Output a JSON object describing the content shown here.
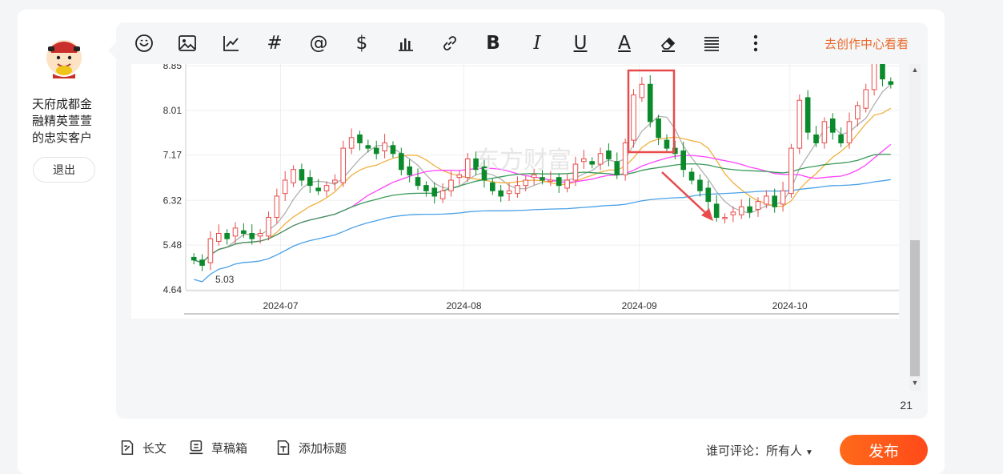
{
  "profile": {
    "name": "天府成都金融精英萱萱的忠实客户",
    "logout_label": "退出"
  },
  "toolbar": {
    "icons": [
      "emoji-icon",
      "image-icon",
      "chart-line-icon",
      "hashtag-icon",
      "mention-icon",
      "stock-dollar-icon",
      "bar-chart-icon",
      "link-icon",
      "bold-icon",
      "italic-icon",
      "underline-icon",
      "font-color-icon",
      "eraser-icon",
      "align-icon",
      "more-icon"
    ],
    "bold": "B",
    "italic": "I",
    "underline": "U",
    "font_color": "A",
    "hashtag": "#",
    "mention": "@",
    "dollar": "$",
    "creator_center_link": "去创作中心看看"
  },
  "colors": {
    "accent": "#e8692a",
    "publish": "#ff5a1f",
    "candle_up": "#e84b4b",
    "candle_down": "#0a8a2a"
  },
  "chart": {
    "y_ticks": [
      "8.85",
      "8.01",
      "7.17",
      "6.32",
      "5.48",
      "4.64"
    ],
    "x_ticks": [
      "2024-07",
      "2024-08",
      "2024-09",
      "2024-10"
    ],
    "low_annotation": "5.03",
    "watermark": "东方财富"
  },
  "chart_data": {
    "type": "candlestick",
    "y_range": [
      4.64,
      8.85
    ],
    "x_labels": [
      "2024-07",
      "2024-08",
      "2024-09",
      "2024-10"
    ],
    "series": [
      {
        "values": [
          5.2,
          5.1,
          5.6,
          5.7,
          5.6,
          5.8,
          5.7,
          5.6,
          5.7,
          6.0,
          6.4,
          6.7,
          6.9,
          6.7,
          6.6,
          6.5,
          6.6,
          6.7,
          7.3,
          7.5,
          7.4,
          7.3,
          7.2,
          7.4,
          7.2,
          6.9,
          6.8,
          6.6,
          6.5,
          6.4,
          6.5,
          6.7,
          6.8,
          7.1,
          6.9,
          6.7,
          6.5,
          6.4,
          6.5,
          6.6,
          6.7,
          6.8,
          6.7,
          6.7,
          6.6,
          6.7,
          7.0,
          7.1,
          7.0,
          7.2,
          7.1,
          6.8,
          7.4,
          8.3,
          8.5,
          7.8,
          7.5,
          7.3,
          7.2,
          6.9,
          6.7,
          6.5,
          6.3,
          6.0,
          6.0,
          6.1,
          6.2,
          6.1,
          6.3,
          6.4,
          6.2,
          6.5,
          7.3,
          8.2,
          7.6,
          7.4,
          7.8,
          7.6,
          7.4,
          7.8,
          8.1,
          8.4,
          8.9,
          8.6,
          8.5
        ]
      }
    ],
    "annotation_low": "5.03"
  },
  "editor": {
    "char_count": "21"
  },
  "bottom": {
    "long_article": "长文",
    "drafts": "草稿箱",
    "add_title": "添加标题",
    "comment_permission_label": "谁可评论：",
    "comment_permission_value": "所有人",
    "publish_label": "发布"
  }
}
